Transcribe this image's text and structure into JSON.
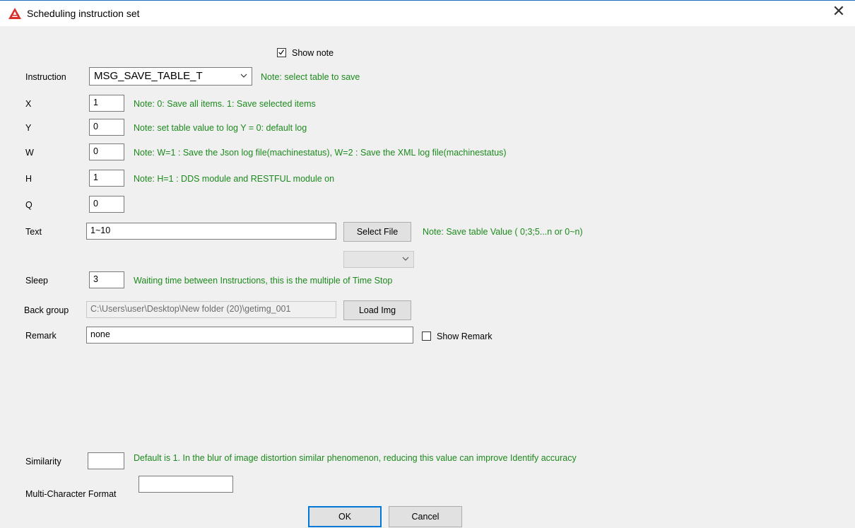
{
  "window": {
    "title": "Scheduling instruction set",
    "close_glyph": "✕",
    "accent_color": "#1e6fbf",
    "icon": "app-logo-icon"
  },
  "show_note": {
    "label": "Show note",
    "checked": true
  },
  "instruction": {
    "label": "Instruction",
    "value": "MSG_SAVE_TABLE_T",
    "note": "Note: select table to save"
  },
  "x": {
    "label": "X",
    "value": "1",
    "note": "Note: 0: Save all items. 1: Save selected items"
  },
  "y": {
    "label": "Y",
    "value": "0",
    "note": "Note: set table value to log  Y = 0: default log"
  },
  "w": {
    "label": "W",
    "value": "0",
    "note": "Note: W=1 : Save the Json log file(machinestatus), W=2 : Save the XML log file(machinestatus)"
  },
  "h": {
    "label": "H",
    "value": "1",
    "note": "Note: H=1 : DDS module and RESTFUL module on"
  },
  "q": {
    "label": "Q",
    "value": "0"
  },
  "text": {
    "label": "Text",
    "value": "1~10",
    "select_file_label": "Select File",
    "note": "Note: Save table Value ( 0;3;5...n or 0~n)",
    "dropdown_value": ""
  },
  "sleep": {
    "label": "Sleep",
    "value": "3",
    "note": "Waiting time between Instructions, this is the multiple of Time Stop"
  },
  "back_group": {
    "label": "Back group",
    "value": "C:\\Users\\user\\Desktop\\New folder (20)\\getimg_001",
    "load_label": "Load Img"
  },
  "remark": {
    "label": "Remark",
    "value": "none",
    "show_remark_label": "Show Remark",
    "show_remark_checked": false
  },
  "similarity": {
    "label": "Similarity",
    "value": "",
    "note": "Default is 1. In the blur of image distortion similar phenomenon, reducing this value can improve Identify accuracy"
  },
  "multi_char": {
    "label": "Multi-Character Format",
    "value": ""
  },
  "buttons": {
    "ok_label": "OK",
    "cancel_label": "Cancel"
  },
  "colors": {
    "note_green": "#1c8a1c",
    "default_button_border": "#0078d7"
  }
}
